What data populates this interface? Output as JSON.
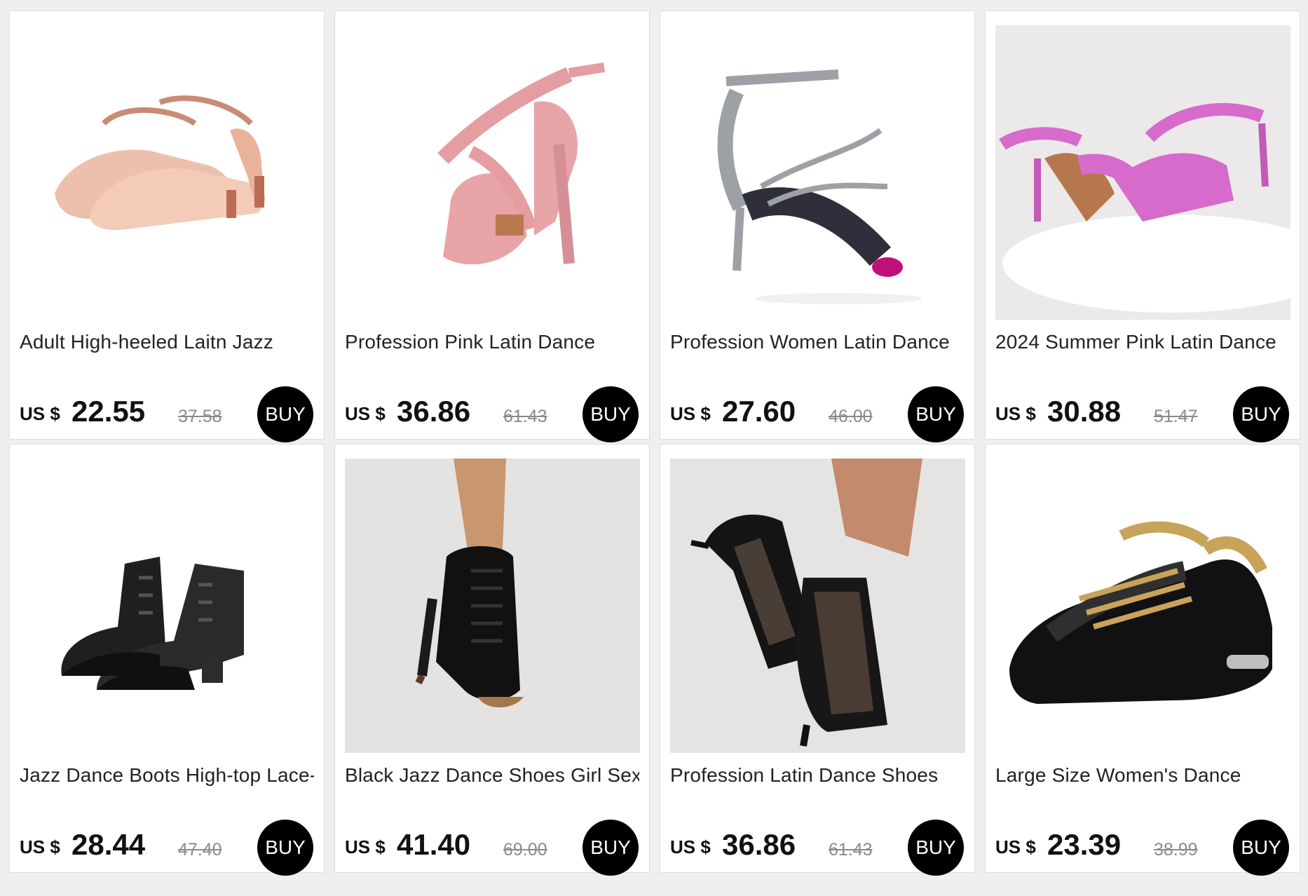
{
  "products": [
    {
      "title": "Adult High-heeled Laitn Jazz",
      "currency": "US $",
      "price": "22.55",
      "original_price": "37.58",
      "buy_label": "BUY",
      "image_colors": [
        "#e9b9a5",
        "#c4846a"
      ],
      "background": "#ffffff"
    },
    {
      "title": "Profession Pink Latin Dance",
      "currency": "US $",
      "price": "36.86",
      "original_price": "61.43",
      "buy_label": "BUY",
      "image_colors": [
        "#e79aa0",
        "#b96c6f"
      ],
      "background": "#ffffff"
    },
    {
      "title": "Profession Women Latin Dance",
      "currency": "US $",
      "price": "27.60",
      "original_price": "46.00",
      "buy_label": "BUY",
      "image_colors": [
        "#9ea1a6",
        "#2e2f3a"
      ],
      "background": "#ffffff"
    },
    {
      "title": "2024 Summer Pink Latin Dance",
      "currency": "US $",
      "price": "30.88",
      "original_price": "51.47",
      "buy_label": "BUY",
      "image_colors": [
        "#d66bcb",
        "#b5774b"
      ],
      "background": "#eceaea"
    },
    {
      "title": "Jazz Dance Boots High-top Lace-",
      "currency": "US $",
      "price": "28.44",
      "original_price": "47.40",
      "buy_label": "BUY",
      "image_colors": [
        "#1a1a1a",
        "#3b3b3b"
      ],
      "background": "#ffffff"
    },
    {
      "title": "Black Jazz Dance Shoes Girl Sexy",
      "currency": "US $",
      "price": "41.40",
      "original_price": "69.00",
      "buy_label": "BUY",
      "image_colors": [
        "#121212",
        "#a5774c"
      ],
      "background": "#e7e5e3"
    },
    {
      "title": "Profession Latin Dance Shoes",
      "currency": "US $",
      "price": "36.86",
      "original_price": "61.43",
      "buy_label": "BUY",
      "image_colors": [
        "#141414",
        "#6d5b4e"
      ],
      "background": "#e5e4e2"
    },
    {
      "title": "Large Size Women's Dance",
      "currency": "US $",
      "price": "23.39",
      "original_price": "38.99",
      "buy_label": "BUY",
      "image_colors": [
        "#101010",
        "#c8a35a"
      ],
      "background": "#ffffff"
    }
  ]
}
